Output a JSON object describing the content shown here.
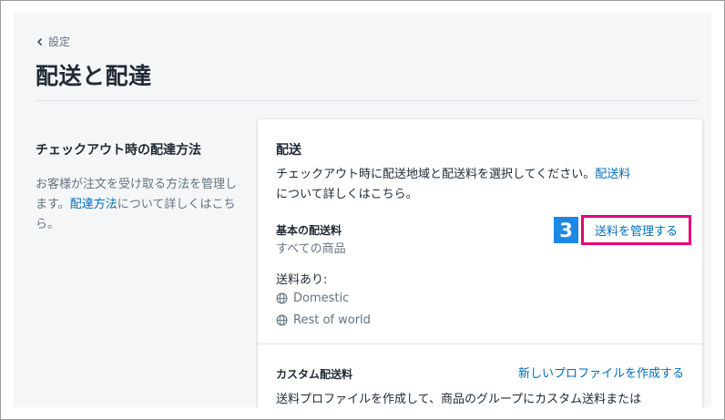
{
  "header": {
    "back_label": "設定",
    "title": "配送と配達"
  },
  "sidebar": {
    "title": "チェックアウト時の配達方法",
    "desc_before": "お客様が注文を受け取る方法を管理します。",
    "desc_link": "配達方法",
    "desc_after": "について詳しくはこちら。"
  },
  "shipping_card": {
    "title": "配送",
    "desc_before": "チェックアウト時に配送地域と配送料を選択してください。",
    "desc_link": "配送料",
    "desc_after": "について詳しくはこちら。",
    "base_rates_label": "基本の配送料",
    "base_rates_sub": "すべての商品",
    "step_number": "3",
    "manage_rates_label": "送料を管理する",
    "rates_label": "送料あり:",
    "zones": [
      "Domestic",
      "Rest of world"
    ],
    "custom_rates_label": "カスタム配送料",
    "new_profile_label": "新しいプロファイルを作成する",
    "custom_desc": "送料プロファイルを作成して、商品のグループにカスタム送料または"
  },
  "colors": {
    "link": "#006fbb",
    "highlight_border": "#e6007e",
    "step_badge": "#1e88e5",
    "page_bg": "#f4f6f8"
  },
  "icons": {
    "back": "chevron-left-icon",
    "zone": "globe-icon"
  }
}
